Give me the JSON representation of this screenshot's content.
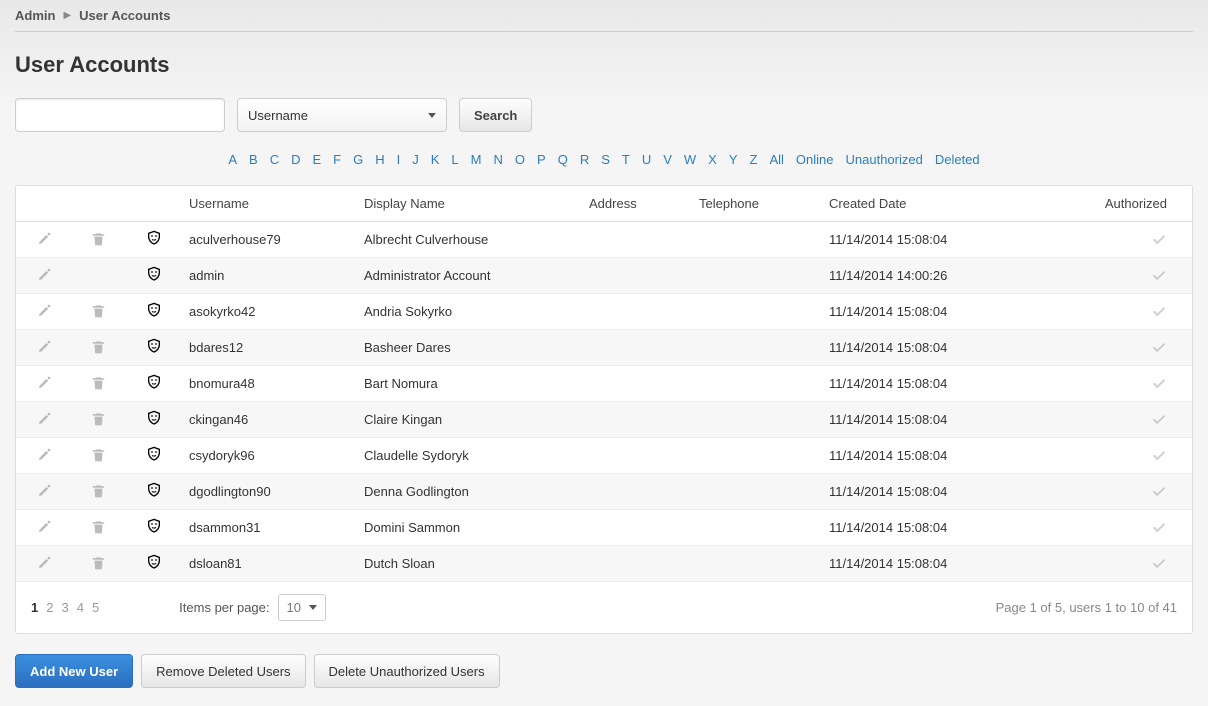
{
  "breadcrumb": {
    "root": "Admin",
    "current": "User Accounts"
  },
  "page_title": "User Accounts",
  "search": {
    "value": "",
    "dropdown_label": "Username",
    "button_label": "Search"
  },
  "alpha_filter": [
    "A",
    "B",
    "C",
    "D",
    "E",
    "F",
    "G",
    "H",
    "I",
    "J",
    "K",
    "L",
    "M",
    "N",
    "O",
    "P",
    "Q",
    "R",
    "S",
    "T",
    "U",
    "V",
    "W",
    "X",
    "Y",
    "Z",
    "All",
    "Online",
    "Unauthorized",
    "Deleted"
  ],
  "table": {
    "headers": {
      "username": "Username",
      "display_name": "Display Name",
      "address": "Address",
      "telephone": "Telephone",
      "created_date": "Created Date",
      "authorized": "Authorized"
    },
    "rows": [
      {
        "username": "aculverhouse79",
        "display_name": "Albrecht Culverhouse",
        "address": "",
        "telephone": "",
        "created_date": "11/14/2014 15:08:04",
        "authorized": true,
        "deletable": true
      },
      {
        "username": "admin",
        "display_name": "Administrator Account",
        "address": "",
        "telephone": "",
        "created_date": "11/14/2014 14:00:26",
        "authorized": true,
        "deletable": false
      },
      {
        "username": "asokyrko42",
        "display_name": "Andria Sokyrko",
        "address": "",
        "telephone": "",
        "created_date": "11/14/2014 15:08:04",
        "authorized": true,
        "deletable": true
      },
      {
        "username": "bdares12",
        "display_name": "Basheer Dares",
        "address": "",
        "telephone": "",
        "created_date": "11/14/2014 15:08:04",
        "authorized": true,
        "deletable": true
      },
      {
        "username": "bnomura48",
        "display_name": "Bart Nomura",
        "address": "",
        "telephone": "",
        "created_date": "11/14/2014 15:08:04",
        "authorized": true,
        "deletable": true
      },
      {
        "username": "ckingan46",
        "display_name": "Claire Kingan",
        "address": "",
        "telephone": "",
        "created_date": "11/14/2014 15:08:04",
        "authorized": true,
        "deletable": true
      },
      {
        "username": "csydoryk96",
        "display_name": "Claudelle Sydoryk",
        "address": "",
        "telephone": "",
        "created_date": "11/14/2014 15:08:04",
        "authorized": true,
        "deletable": true
      },
      {
        "username": "dgodlington90",
        "display_name": "Denna Godlington",
        "address": "",
        "telephone": "",
        "created_date": "11/14/2014 15:08:04",
        "authorized": true,
        "deletable": true
      },
      {
        "username": "dsammon31",
        "display_name": "Domini Sammon",
        "address": "",
        "telephone": "",
        "created_date": "11/14/2014 15:08:04",
        "authorized": true,
        "deletable": true
      },
      {
        "username": "dsloan81",
        "display_name": "Dutch Sloan",
        "address": "",
        "telephone": "",
        "created_date": "11/14/2014 15:08:04",
        "authorized": true,
        "deletable": true
      }
    ]
  },
  "pagination": {
    "pages": [
      "1",
      "2",
      "3",
      "4",
      "5"
    ],
    "current": "1",
    "per_page_label": "Items per page:",
    "per_page_value": "10",
    "summary": "Page 1 of 5, users 1 to 10 of 41"
  },
  "actions": {
    "add_user": "Add New User",
    "remove_deleted": "Remove Deleted Users",
    "delete_unauthorized": "Delete Unauthorized Users"
  }
}
